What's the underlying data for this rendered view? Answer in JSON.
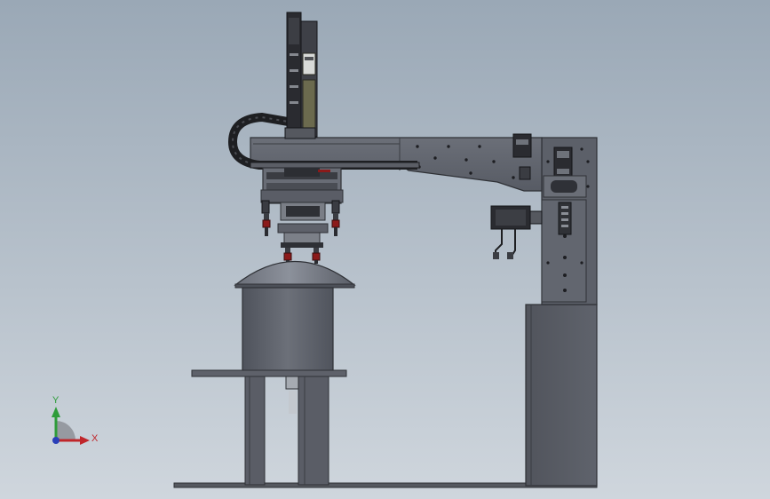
{
  "viewport": {
    "background_top": "#9aa8b6",
    "background_bottom": "#cfd6dd"
  },
  "model": {
    "body_color": "#5a5d66",
    "dark_color": "#2b2d33",
    "steel_color": "#808690",
    "accent_red": "#8b1a1a",
    "cable_chain_color": "#1e1f22"
  },
  "triad": {
    "x_label": "X",
    "y_label": "Y",
    "x_color": "#c0262b",
    "y_color": "#2e9c3a",
    "z_color": "#2a3fb8",
    "x_icon": "x-axis-arrow-icon",
    "y_icon": "y-axis-arrow-icon",
    "z_icon": "z-axis-dot-icon"
  }
}
